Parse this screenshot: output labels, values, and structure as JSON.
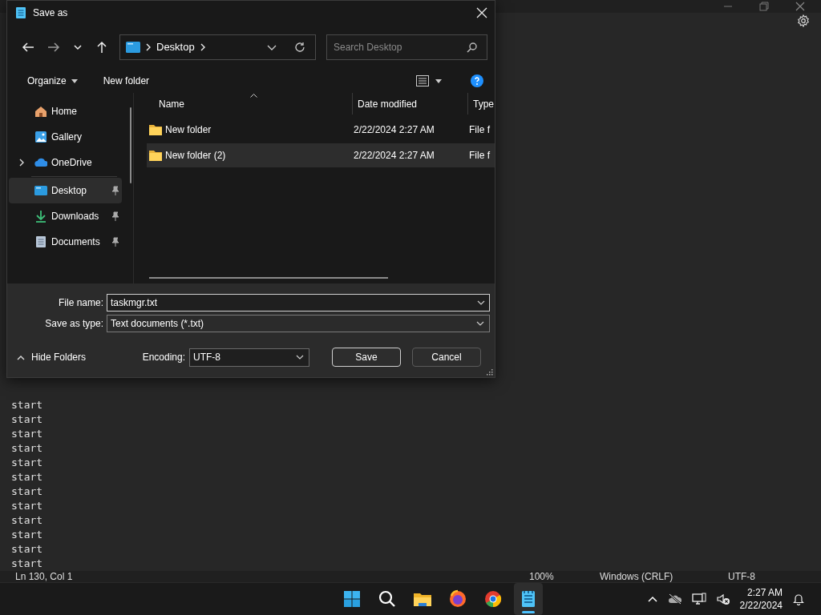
{
  "notepad": {
    "editor_lines": [
      "start",
      "start",
      "start",
      "start",
      "start",
      "start",
      "start",
      "start",
      "start",
      "start",
      "start",
      "start"
    ],
    "status_bar": {
      "position": "Ln 130, Col 1",
      "zoom": "100%",
      "line_ending": "Windows (CRLF)",
      "encoding": "UTF-8"
    }
  },
  "dialog": {
    "title": "Save as",
    "address": {
      "segments": [
        "Desktop"
      ]
    },
    "search": {
      "placeholder": "Search Desktop"
    },
    "commands": [
      "Organize",
      "New folder"
    ],
    "nav_groups": [
      {
        "items": [
          {
            "kind": "home",
            "label": "Home",
            "expandable": false,
            "pinned": false,
            "selected": false
          },
          {
            "kind": "gallery",
            "label": "Gallery",
            "expandable": false,
            "pinned": false,
            "selected": false
          },
          {
            "kind": "cloud",
            "label": "OneDrive",
            "expandable": true,
            "pinned": false,
            "selected": false
          }
        ]
      },
      {
        "items": [
          {
            "kind": "desktop",
            "label": "Desktop",
            "expandable": false,
            "pinned": true,
            "selected": true
          },
          {
            "kind": "downloads",
            "label": "Downloads",
            "expandable": false,
            "pinned": true,
            "selected": false
          },
          {
            "kind": "documents",
            "label": "Documents",
            "expandable": false,
            "pinned": true,
            "selected": false
          }
        ]
      }
    ],
    "columns": [
      {
        "label": "Name",
        "sorted": true
      },
      {
        "label": "Date modified",
        "sorted": false
      },
      {
        "label": "Type",
        "sorted": false
      }
    ],
    "rows": [
      {
        "name": "New folder",
        "date": "2/22/2024 2:27 AM",
        "type": "File f",
        "selected": false
      },
      {
        "name": "New folder (2)",
        "date": "2/22/2024 2:27 AM",
        "type": "File f",
        "selected": true
      }
    ],
    "file_name_label": "File name:",
    "file_name": "taskmgr.txt",
    "type_label": "Save as type:",
    "save_as_type": "Text documents (*.txt)",
    "hide_folders": "Hide Folders",
    "encoding_label": "Encoding:",
    "encoding": "UTF-8",
    "buttons": [
      {
        "label": "Save",
        "default": true
      },
      {
        "label": "Cancel",
        "default": false
      }
    ]
  },
  "taskbar": {
    "apps": [
      {
        "kind": "start",
        "active": false
      },
      {
        "kind": "search",
        "active": false
      },
      {
        "kind": "files",
        "active": false
      },
      {
        "kind": "fox",
        "active": false
      },
      {
        "kind": "chrome",
        "active": false
      },
      {
        "kind": "notepad",
        "active": true
      }
    ],
    "clock": {
      "time": "2:27 AM",
      "date": "2/22/2024"
    }
  }
}
